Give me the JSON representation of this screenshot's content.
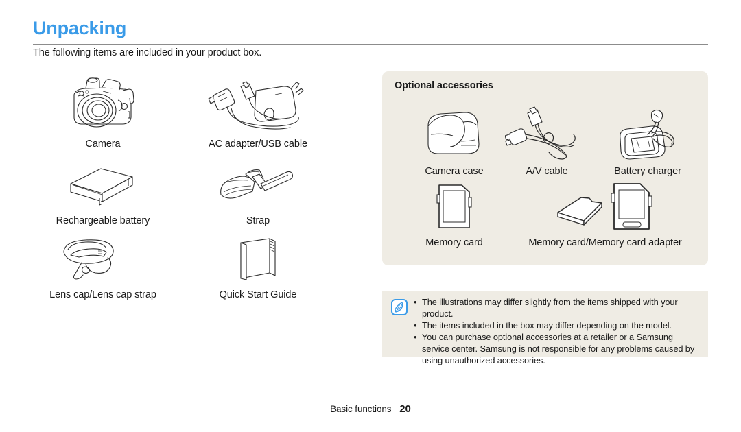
{
  "header": {
    "title": "Unpacking",
    "title_color": "#3a9be8",
    "intro": "The following items are included in your product box."
  },
  "included_items": [
    {
      "label": "Camera",
      "icon": "camera-icon"
    },
    {
      "label": "AC adapter/USB cable",
      "icon": "ac-adapter-usb-cable-icon"
    },
    {
      "label": "Rechargeable battery",
      "icon": "battery-icon"
    },
    {
      "label": "Strap",
      "icon": "strap-icon"
    },
    {
      "label": "Lens cap/Lens cap strap",
      "icon": "lens-cap-icon"
    },
    {
      "label": "Quick Start Guide",
      "icon": "quick-start-guide-icon"
    }
  ],
  "optional": {
    "heading": "Optional accessories",
    "background_color": "#efece4",
    "items": [
      {
        "label": "Camera case",
        "icon": "camera-case-icon"
      },
      {
        "label": "A/V cable",
        "icon": "av-cable-icon"
      },
      {
        "label": "Battery charger",
        "icon": "battery-charger-icon"
      },
      {
        "label": "Memory card",
        "icon": "memory-card-icon"
      },
      {
        "label": "Memory card/Memory card adapter",
        "icon": "memory-card-adapter-icon"
      }
    ]
  },
  "note": {
    "icon": "note-pen-icon",
    "icon_color": "#3a9be8",
    "background_color": "#efece4",
    "bullet": "•",
    "lines": [
      "The illustrations may differ slightly from the items shipped with your product.",
      "The items included in the box may differ depending on the model.",
      "You can purchase optional accessories at a retailer or a Samsung service center. Samsung is not responsible for any problems caused by using unauthorized accessories."
    ]
  },
  "footer": {
    "section": "Basic functions",
    "page": "20"
  }
}
